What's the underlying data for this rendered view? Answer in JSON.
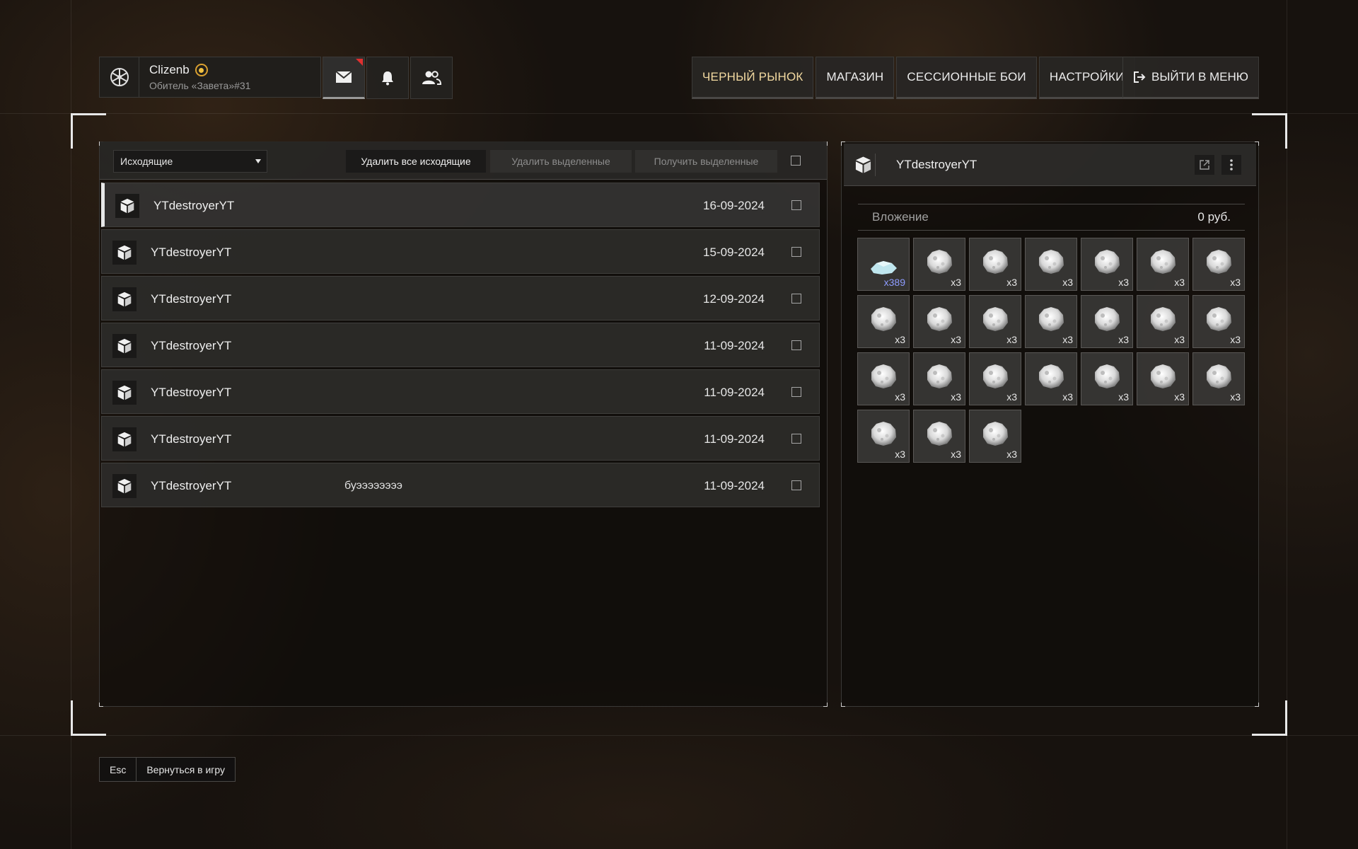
{
  "profile": {
    "name": "Clizenb",
    "subtitle": "Обитель «Завета»#31"
  },
  "nav": {
    "black_market": "ЧЕРНЫЙ РЫНОК",
    "shop": "МАГАЗИН",
    "session_battles": "СЕССИОННЫЕ БОИ",
    "settings": "НАСТРОЙКИ",
    "exit": "ВЫЙТИ В МЕНЮ"
  },
  "mail": {
    "folder": "Исходящие",
    "delete_all": "Удалить все исходящие",
    "delete_selected": "Удалить выделенные",
    "receive_selected": "Получить выделенные",
    "rows": [
      {
        "name": "YTdestroyerYT",
        "message": "",
        "date": "16-09-2024"
      },
      {
        "name": "YTdestroyerYT",
        "message": "",
        "date": "15-09-2024"
      },
      {
        "name": "YTdestroyerYT",
        "message": "",
        "date": "12-09-2024"
      },
      {
        "name": "YTdestroyerYT",
        "message": "",
        "date": "11-09-2024"
      },
      {
        "name": "YTdestroyerYT",
        "message": "",
        "date": "11-09-2024"
      },
      {
        "name": "YTdestroyerYT",
        "message": "",
        "date": "11-09-2024"
      },
      {
        "name": "YTdestroyerYT",
        "message": "буээээээээ",
        "date": "11-09-2024"
      }
    ]
  },
  "detail": {
    "title": "YTdestroyerYT",
    "attachment_label": "Вложение",
    "attachment_value": "0 руб.",
    "items": [
      {
        "icon": "crystal-icon",
        "count": "x389"
      },
      {
        "icon": "rock-icon",
        "count": "x3"
      },
      {
        "icon": "rock-icon",
        "count": "x3"
      },
      {
        "icon": "rock-icon",
        "count": "x3"
      },
      {
        "icon": "rock-icon",
        "count": "x3"
      },
      {
        "icon": "rock-icon",
        "count": "x3"
      },
      {
        "icon": "rock-icon",
        "count": "x3"
      },
      {
        "icon": "rock-icon",
        "count": "x3"
      },
      {
        "icon": "rock-icon",
        "count": "x3"
      },
      {
        "icon": "rock-icon",
        "count": "x3"
      },
      {
        "icon": "rock-icon",
        "count": "x3"
      },
      {
        "icon": "rock-icon",
        "count": "x3"
      },
      {
        "icon": "rock-icon",
        "count": "x3"
      },
      {
        "icon": "rock-icon",
        "count": "x3"
      },
      {
        "icon": "rock-icon",
        "count": "x3"
      },
      {
        "icon": "rock-icon",
        "count": "x3"
      },
      {
        "icon": "rock-icon",
        "count": "x3"
      },
      {
        "icon": "rock-icon",
        "count": "x3"
      },
      {
        "icon": "rock-icon",
        "count": "x3"
      },
      {
        "icon": "rock-icon",
        "count": "x3"
      },
      {
        "icon": "rock-icon",
        "count": "x3"
      },
      {
        "icon": "rock-icon",
        "count": "x3"
      },
      {
        "icon": "rock-icon",
        "count": "x3"
      },
      {
        "icon": "rock-icon",
        "count": "x3"
      }
    ]
  },
  "footer": {
    "key": "Esc",
    "label": "Вернуться в игру"
  },
  "colors": {
    "accent_gold": "#f2d9a0",
    "notification_red": "#e03030",
    "count_blue": "#8e9cff"
  }
}
